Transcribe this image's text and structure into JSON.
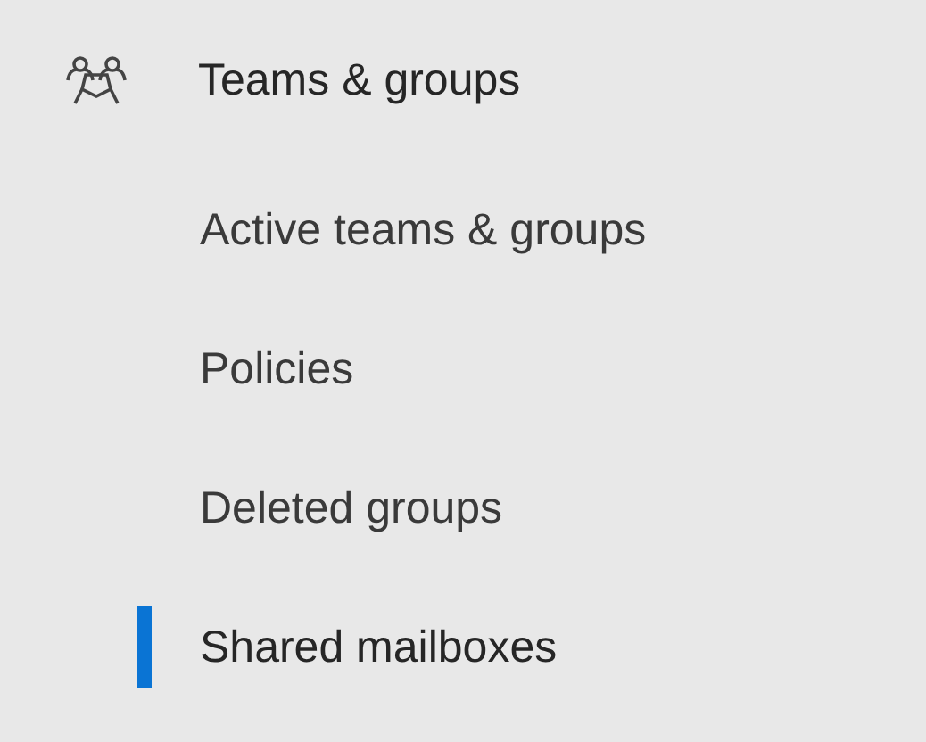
{
  "nav_group": {
    "label": "Teams & groups",
    "items": [
      {
        "label": "Active teams & groups",
        "selected": false
      },
      {
        "label": "Policies",
        "selected": false
      },
      {
        "label": "Deleted groups",
        "selected": false
      },
      {
        "label": "Shared mailboxes",
        "selected": true
      }
    ]
  }
}
